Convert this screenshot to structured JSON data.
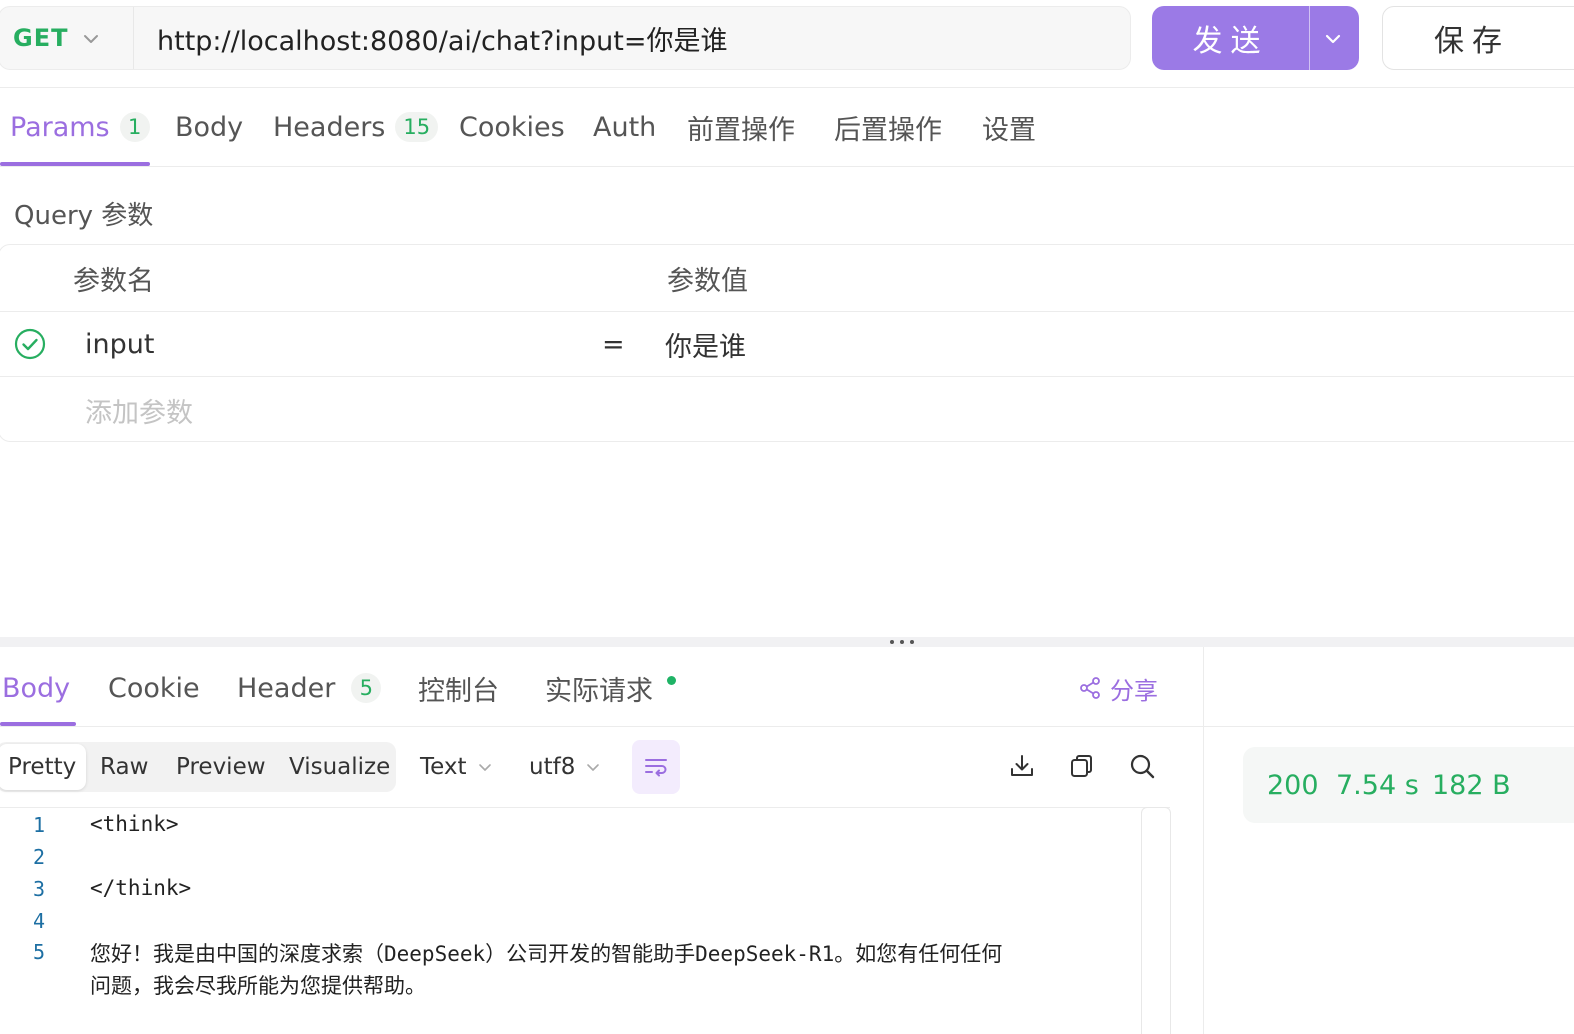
{
  "request": {
    "method": "GET",
    "url": "http://localhost:8080/ai/chat?input=你是谁",
    "send_label": "发送",
    "save_label": "保存"
  },
  "request_tabs": [
    {
      "label": "Params",
      "badge": "1"
    },
    {
      "label": "Body"
    },
    {
      "label": "Headers",
      "badge": "15"
    },
    {
      "label": "Cookies"
    },
    {
      "label": "Auth"
    },
    {
      "label": "前置操作"
    },
    {
      "label": "后置操作"
    },
    {
      "label": "设置"
    }
  ],
  "query": {
    "title": "Query 参数",
    "col_name": "参数名",
    "col_value": "参数值",
    "params": [
      {
        "name": "input",
        "op": "=",
        "value": "你是谁",
        "enabled": true
      }
    ],
    "add_placeholder": "添加参数"
  },
  "response_tabs": [
    {
      "label": "Body"
    },
    {
      "label": "Cookie"
    },
    {
      "label": "Header",
      "badge": "5"
    },
    {
      "label": "控制台"
    },
    {
      "label": "实际请求"
    }
  ],
  "share_label": "分享",
  "view_modes": [
    "Pretty",
    "Raw",
    "Preview",
    "Visualize"
  ],
  "format": {
    "type": "Text",
    "encoding": "utf8"
  },
  "stats": {
    "status": "200",
    "time": "7.54 s",
    "size": "182 B"
  },
  "code": {
    "line_numbers": [
      "1",
      "2",
      "3",
      "4",
      "5"
    ],
    "lines": [
      "<think>",
      "",
      "</think>",
      "",
      "您好！我是由中国的深度求索（DeepSeek）公司开发的智能助手DeepSeek-R1。如您有任何任何",
      "问题，我会尽我所能为您提供帮助。"
    ]
  },
  "colors": {
    "accent": "#9b6ee0",
    "success": "#27ae60"
  }
}
